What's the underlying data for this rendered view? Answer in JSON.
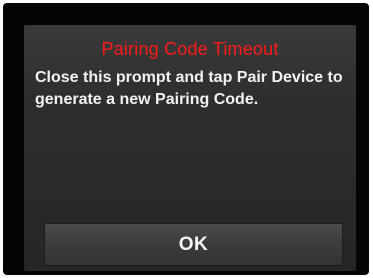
{
  "dialog": {
    "title": "Pairing Code Timeout",
    "message": "Close this prompt and tap Pair Device to generate a new Pairing Code.",
    "ok_label": "OK"
  },
  "colors": {
    "title": "#ff1a1a",
    "message": "#f2f2f2",
    "panel": "#2e2e2e",
    "frame": "#050505"
  }
}
